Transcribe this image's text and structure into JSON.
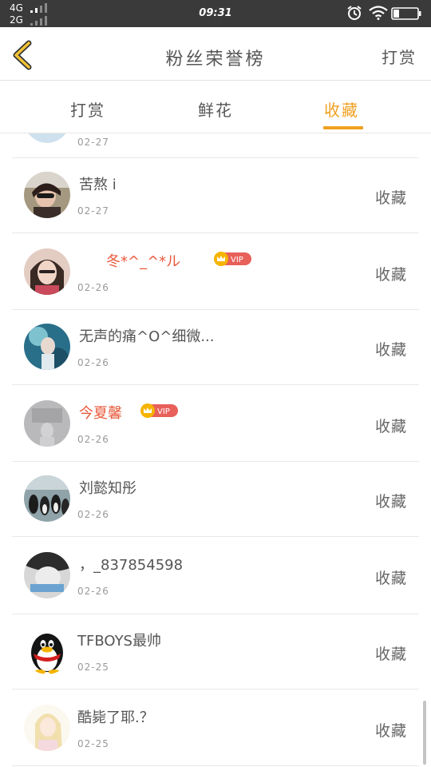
{
  "status_bar": {
    "network_top": "4G",
    "network_bottom": "2G",
    "time": "09:31"
  },
  "header": {
    "title": "粉丝荣誉榜",
    "action_label": "打赏"
  },
  "tabs": [
    {
      "label": "打赏",
      "active": false
    },
    {
      "label": "鲜花",
      "active": false
    },
    {
      "label": "收藏",
      "active": true
    }
  ],
  "colors": {
    "accent": "#f0a020",
    "vip_name": "#e85a3c",
    "vip_badge": "#e8605a",
    "crown": "#f5b400",
    "status_bar": "#3a3a3a"
  },
  "partial_row": {
    "date": "02-27"
  },
  "rows": [
    {
      "name": "苦熬 i",
      "date": "02-27",
      "vip": false,
      "action": "收藏"
    },
    {
      "name": "冬*^_^*ル",
      "date": "02-26",
      "vip": true,
      "vip_label": "VIP",
      "action": "收藏"
    },
    {
      "name": "无声的痛^O^细微...",
      "date": "02-26",
      "vip": false,
      "action": "收藏"
    },
    {
      "name": "今夏馨",
      "date": "02-26",
      "vip": true,
      "vip_label": "VIP",
      "action": "收藏"
    },
    {
      "name": "刘懿知彤",
      "date": "02-26",
      "vip": false,
      "action": "收藏"
    },
    {
      "name": "，_837854598",
      "date": "02-26",
      "vip": false,
      "action": "收藏"
    },
    {
      "name": "TFBOYS最帅",
      "date": "02-25",
      "vip": false,
      "action": "收藏"
    },
    {
      "name": "酷毙了耶.？",
      "date": "02-25",
      "vip": false,
      "action": "收藏"
    }
  ]
}
